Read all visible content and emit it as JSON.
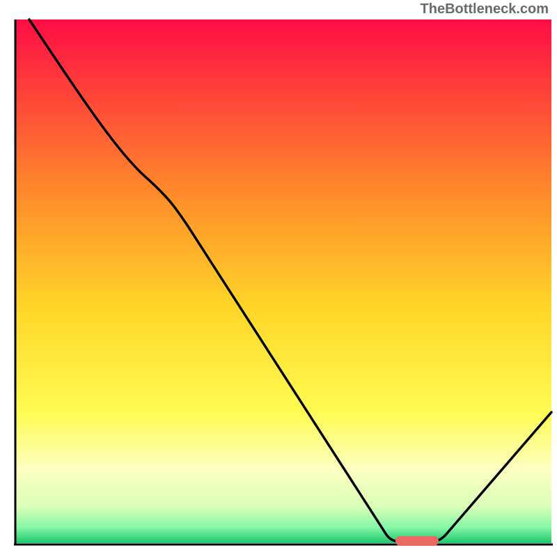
{
  "watermark": "TheBottleneck.com",
  "chart_data": {
    "type": "line",
    "title": "",
    "xlabel": "",
    "ylabel": "",
    "xlim": [
      0,
      100
    ],
    "ylim": [
      0,
      100
    ],
    "grid": false,
    "background": {
      "type": "vertical_gradient",
      "stops": [
        {
          "offset": 0,
          "color": "#ff0d45"
        },
        {
          "offset": 33,
          "color": "#ff8a2a"
        },
        {
          "offset": 55,
          "color": "#ffd628"
        },
        {
          "offset": 75,
          "color": "#fffb52"
        },
        {
          "offset": 86,
          "color": "#fdffc2"
        },
        {
          "offset": 93,
          "color": "#d9ffb8"
        },
        {
          "offset": 97,
          "color": "#86f7a6"
        },
        {
          "offset": 100,
          "color": "#1cc96d"
        }
      ]
    },
    "series": [
      {
        "name": "bottleneck_curve",
        "color": "#000000",
        "points": [
          {
            "x": 3,
            "y": 100
          },
          {
            "x": 24,
            "y": 71
          },
          {
            "x": 70,
            "y": 1
          },
          {
            "x": 72,
            "y": 0
          },
          {
            "x": 78,
            "y": 0
          },
          {
            "x": 80,
            "y": 1
          },
          {
            "x": 100,
            "y": 25
          }
        ]
      }
    ],
    "markers": [
      {
        "name": "optimal_pill",
        "shape": "pill",
        "x_center": 75,
        "y": 0.5,
        "width": 7,
        "color": "#ea6a63"
      }
    ]
  }
}
